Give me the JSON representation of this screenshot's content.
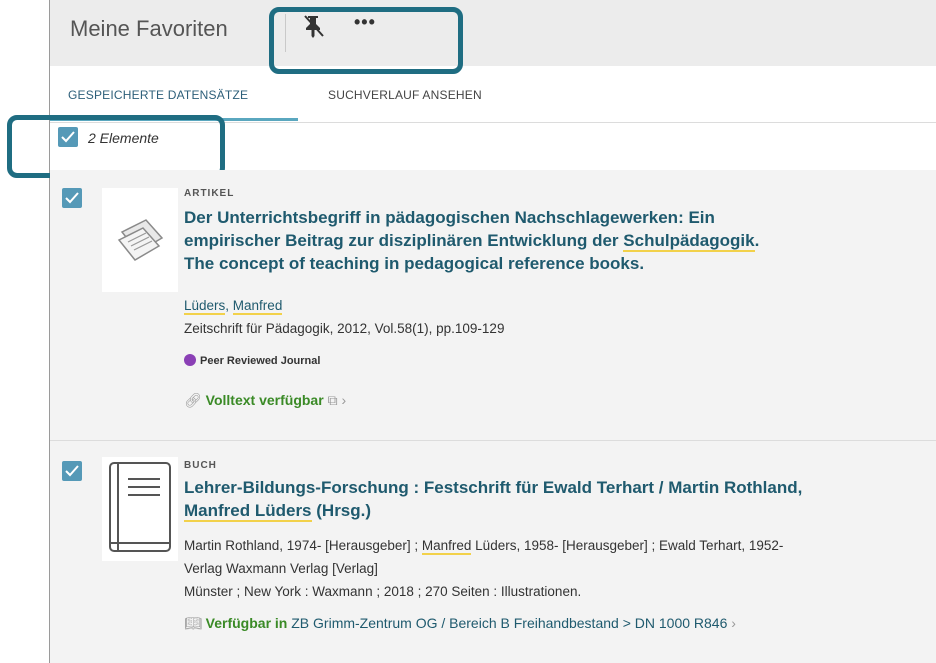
{
  "header": {
    "title": "Meine Favoriten",
    "more_label": "•••"
  },
  "tabs": [
    {
      "label": "GESPEICHERTE DATENSÄTZE"
    },
    {
      "label": "SUCHVERLAUF ANSEHEN"
    }
  ],
  "selection": {
    "label": "2 Elemente"
  },
  "results": [
    {
      "type": "ARTIKEL",
      "title_line1": "Der Unterrichtsbegriff in pädagogischen Nachschlagewerken: Ein",
      "title_line2_pre": "empirischer Beitrag zur disziplinären Entwicklung der ",
      "title_line2_hl": "Schulpädagogik",
      "title_line2_post": ".",
      "title_line3": "The concept of teaching in pedagogical reference books.",
      "author_last": "Lüders",
      "author_sep": ", ",
      "author_first": "Manfred",
      "source": "Zeitschrift für Pädagogik, 2012, Vol.58(1), pp.109-129",
      "peer": "Peer Reviewed Journal",
      "avail": "Volltext verfügbar",
      "avail_arrow": "›"
    },
    {
      "type": "BUCH",
      "title_line1": "Lehrer-Bildungs-Forschung : Festschrift für Ewald Terhart / Martin Rothland,",
      "title_line2_hl": "Manfred Lüders",
      "title_line2_post": " (Hrsg.)",
      "contrib_pre": "Martin Rothland, 1974- [Herausgeber] ; ",
      "contrib_hl": "Manfred",
      "contrib_post": " Lüders, 1958- [Herausgeber] ; Ewald Terhart, 1952-",
      "publisher": "Verlag Waxmann Verlag [Verlag]",
      "imprint": "Münster ; New York : Waxmann ; 2018 ; 270 Seiten : Illustrationen.",
      "avail": "Verfügbar in",
      "location": " ZB Grimm-Zentrum  OG / Bereich B Freihandbestand > DN 1000 R846",
      "avail_arrow": "›"
    }
  ],
  "colors": {
    "accent": "#5599b7",
    "link": "#1f5a6e",
    "available": "#3a8a26",
    "highlight": "#f2d14a",
    "callout": "#1f6d82"
  },
  "icons": [
    "pin-off-icon",
    "more-icon",
    "check-icon",
    "article-icon",
    "book-icon",
    "link-icon",
    "external-link-icon",
    "library-icon"
  ]
}
